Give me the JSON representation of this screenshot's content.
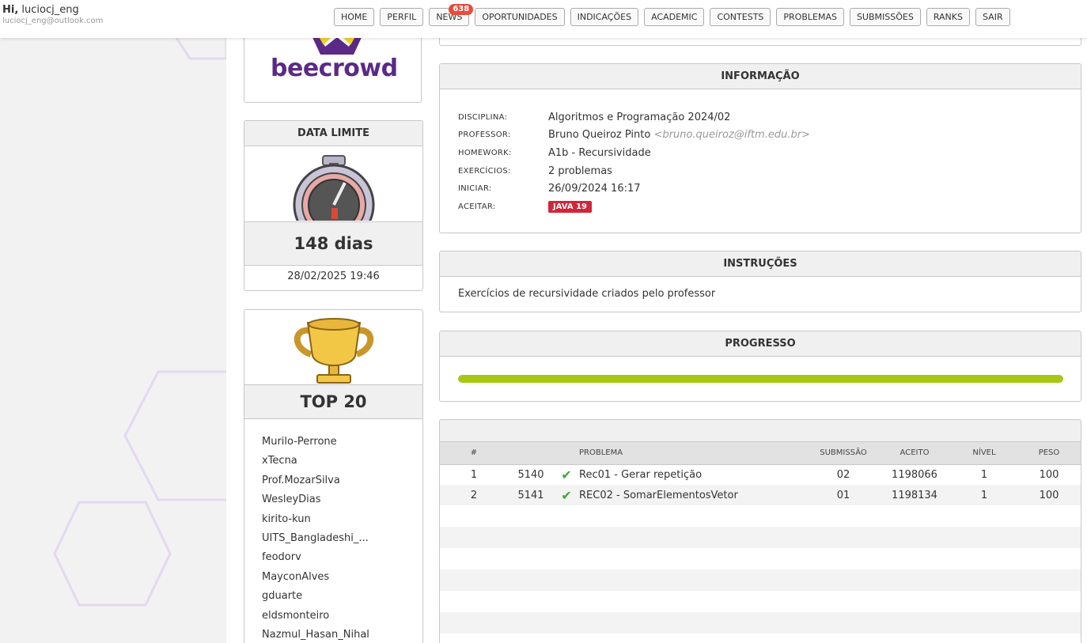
{
  "user": {
    "greeting": "Hi,",
    "username": "luciocj_eng",
    "email": "luciocj_eng@outlook.com"
  },
  "nav": [
    {
      "label": "HOME"
    },
    {
      "label": "PERFIL"
    },
    {
      "label": "NEWS",
      "badge": "638"
    },
    {
      "label": "OPORTUNIDADES"
    },
    {
      "label": "INDICAÇÕES"
    },
    {
      "label": "ACADEMIC"
    },
    {
      "label": "CONTESTS"
    },
    {
      "label": "PROBLEMAS"
    },
    {
      "label": "SUBMISSÕES"
    },
    {
      "label": "RANKS"
    },
    {
      "label": "SAIR"
    }
  ],
  "logo": {
    "text": "beecrowd"
  },
  "deadline": {
    "title": "DATA LIMITE",
    "days": "148 dias",
    "date": "28/02/2025 19:46"
  },
  "top20": {
    "title": "TOP 20",
    "users": [
      "Murilo-Perrone",
      "xTecna",
      "Prof.MozarSilva",
      "WesleyDias",
      "kirito-kun",
      "UITS_Bangladeshi_...",
      "feodorv",
      "MayconAlves",
      "gduarte",
      "eldsmonteiro",
      "Nazmul_Hasan_Nihal"
    ]
  },
  "info": {
    "title": "INFORMAÇÃO",
    "rows": [
      {
        "key": "DISCIPLINA:",
        "value": "Algoritmos e Programação 2024/02"
      },
      {
        "key": "PROFESSOR:",
        "value": "Bruno Queiroz Pinto",
        "extra": "<bruno.queiroz@iftm.edu.br>"
      },
      {
        "key": "HOMEWORK:",
        "value": "A1b - Recursividade"
      },
      {
        "key": "EXERCÍCIOS:",
        "value": "2 problemas"
      },
      {
        "key": "INICIAR:",
        "value": "26/09/2024 16:17"
      },
      {
        "key": "ACEITAR:",
        "tag": "JAVA 19"
      }
    ]
  },
  "instructions": {
    "title": "INSTRUÇÕES",
    "text": "Exercícios de recursividade criados pelo professor"
  },
  "progress": {
    "title": "PROGRESSO",
    "percent": 100,
    "color": "#a8c715"
  },
  "table": {
    "headers": {
      "num": "#",
      "problem": "PROBLEMA",
      "submission": "SUBMISSÃO",
      "accepted": "ACEITO",
      "level": "NÍVEL",
      "weight": "PESO"
    },
    "rows": [
      {
        "num": "1",
        "id": "5140",
        "name": "Rec01 - Gerar repetição",
        "submission": "02",
        "accepted": "1198066",
        "level": "1",
        "weight": "100"
      },
      {
        "num": "2",
        "id": "5141",
        "name": "REC02 - SomarElementosVetor",
        "submission": "01",
        "accepted": "1198134",
        "level": "1",
        "weight": "100"
      }
    ]
  }
}
